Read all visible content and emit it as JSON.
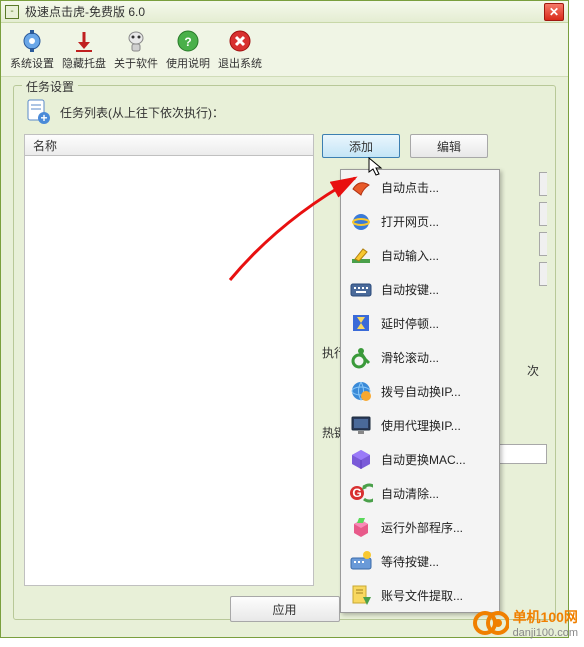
{
  "window": {
    "title": "极速点击虎-免费版 6.0"
  },
  "toolbar": {
    "items": [
      {
        "label": "系统设置"
      },
      {
        "label": "隐藏托盘"
      },
      {
        "label": "关于软件"
      },
      {
        "label": "使用说明"
      },
      {
        "label": "退出系统"
      }
    ]
  },
  "fieldset": {
    "legend": "任务设置"
  },
  "task_header": {
    "text": "任务列表(从上往下依次执行)："
  },
  "list": {
    "col_name": "名称"
  },
  "buttons": {
    "add": "添加",
    "edit": "编辑",
    "apply": "应用"
  },
  "labels": {
    "exec": "执行",
    "hotkey": "热键",
    "times": "次"
  },
  "dropdown": {
    "items": [
      {
        "label": "自动点击..."
      },
      {
        "label": "打开网页..."
      },
      {
        "label": "自动输入..."
      },
      {
        "label": "自动按键..."
      },
      {
        "label": "延时停顿..."
      },
      {
        "label": "滑轮滚动..."
      },
      {
        "label": "拨号自动换IP..."
      },
      {
        "label": "使用代理换IP..."
      },
      {
        "label": "自动更换MAC..."
      },
      {
        "label": "自动清除..."
      },
      {
        "label": "运行外部程序..."
      },
      {
        "label": "等待按键..."
      },
      {
        "label": "账号文件提取..."
      }
    ]
  },
  "watermark": {
    "main": "单机100网",
    "sub": "danji100.com"
  }
}
